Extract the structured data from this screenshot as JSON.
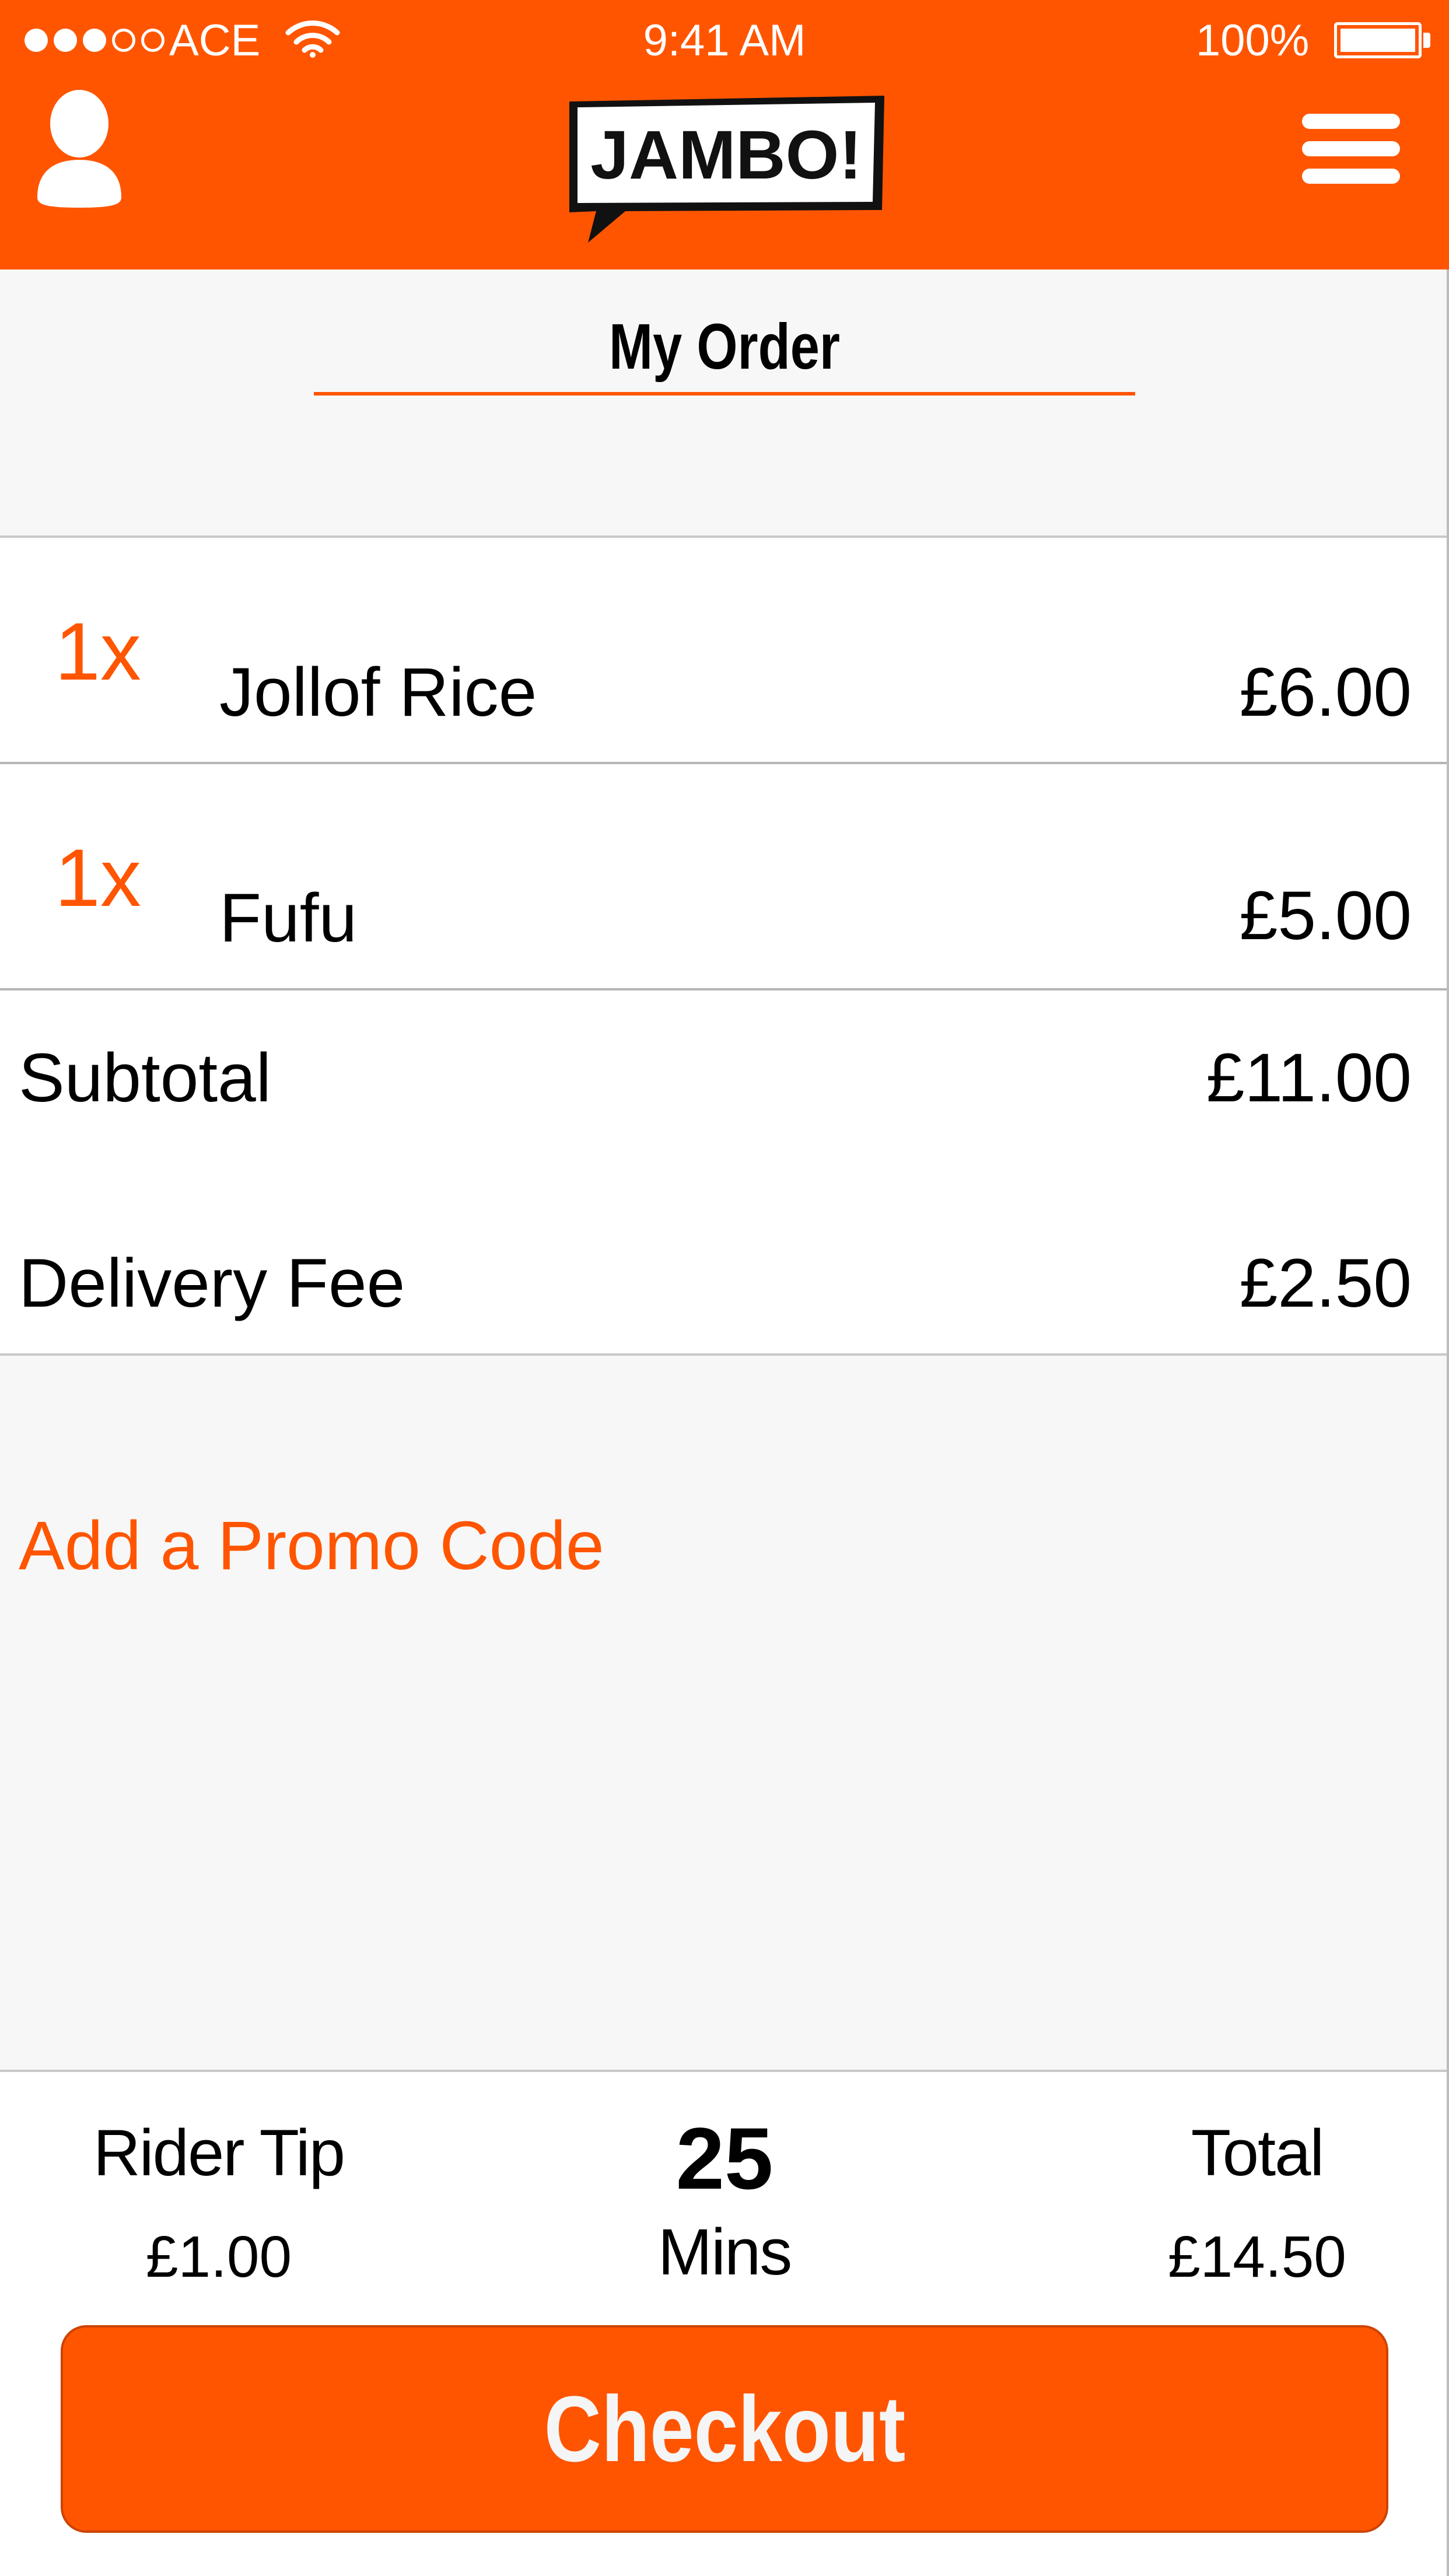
{
  "status_bar": {
    "carrier": "ACE",
    "time": "9:41 AM",
    "battery": "100%",
    "signal_bars_filled": 3,
    "signal_bars_total": 5
  },
  "header": {
    "logo_text": "JAMBO!",
    "profile_icon": "user-icon",
    "menu_icon": "hamburger-menu-icon"
  },
  "page": {
    "title": "My Order"
  },
  "items": [
    {
      "qty": "1x",
      "name": "Jollof Rice",
      "price": "£6.00"
    },
    {
      "qty": "1x",
      "name": "Fufu",
      "price": "£5.00"
    }
  ],
  "totals": {
    "subtotal_label": "Subtotal",
    "subtotal_value": "£11.00",
    "delivery_label": "Delivery Fee",
    "delivery_value": "£2.50"
  },
  "promo": {
    "label": "Add a Promo Code"
  },
  "summary": {
    "tip_label": "Rider Tip",
    "tip_value": "£1.00",
    "eta_value": "25",
    "eta_unit": "Mins",
    "total_label": "Total",
    "total_value": "£14.50"
  },
  "checkout": {
    "label": "Checkout"
  },
  "colors": {
    "brand": "#ff5500",
    "background_grey": "#f7f7f7"
  }
}
